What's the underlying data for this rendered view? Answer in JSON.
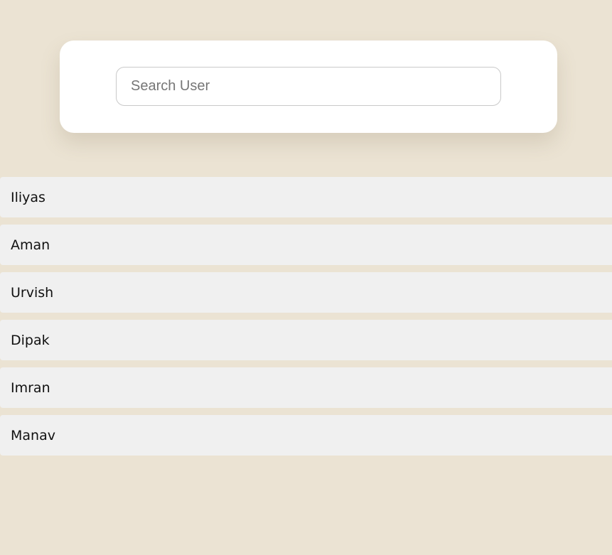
{
  "search": {
    "placeholder": "Search User",
    "value": ""
  },
  "users": [
    {
      "name": "Iliyas"
    },
    {
      "name": "Aman"
    },
    {
      "name": "Urvish"
    },
    {
      "name": "Dipak"
    },
    {
      "name": "Imran"
    },
    {
      "name": "Manav"
    }
  ],
  "colors": {
    "page_background": "#ebe3d3",
    "card_background": "#ffffff",
    "list_item_background": "#f0f0f0"
  }
}
